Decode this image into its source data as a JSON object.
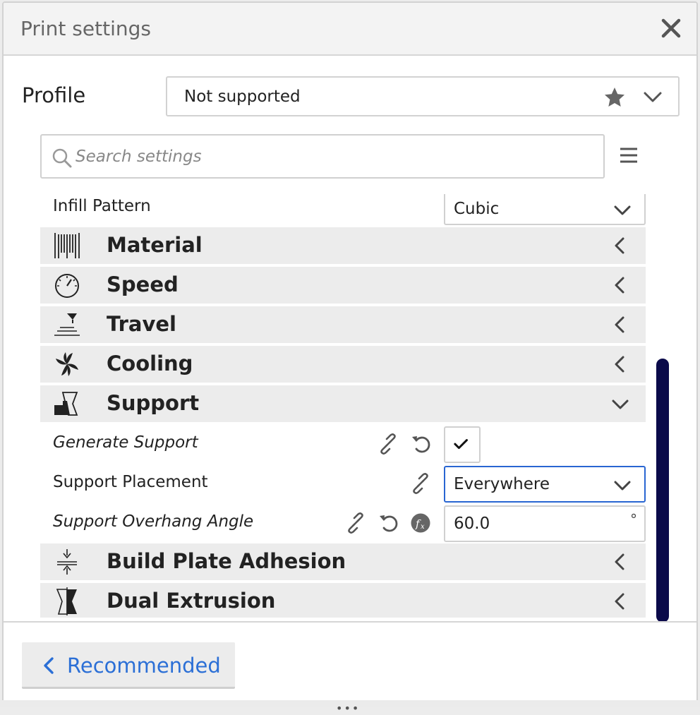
{
  "window": {
    "title": "Print settings"
  },
  "profile": {
    "label": "Profile",
    "value": "Not supported"
  },
  "search": {
    "placeholder": "Search settings"
  },
  "settings": {
    "infill_pattern": {
      "label": "Infill Pattern",
      "value": "Cubic"
    },
    "categories": [
      {
        "name": "Material",
        "icon": "material-icon",
        "expanded": false
      },
      {
        "name": "Speed",
        "icon": "speed-gauge-icon",
        "expanded": false
      },
      {
        "name": "Travel",
        "icon": "travel-icon",
        "expanded": false
      },
      {
        "name": "Cooling",
        "icon": "fan-icon",
        "expanded": false
      },
      {
        "name": "Support",
        "icon": "support-icon",
        "expanded": true
      },
      {
        "name": "Build Plate Adhesion",
        "icon": "adhesion-icon",
        "expanded": false
      },
      {
        "name": "Dual Extrusion",
        "icon": "dual-extrusion-icon",
        "expanded": false
      }
    ],
    "support": {
      "generate_support": {
        "label": "Generate Support",
        "checked": true
      },
      "support_placement": {
        "label": "Support Placement",
        "value": "Everywhere"
      },
      "overhang_angle": {
        "label": "Support Overhang Angle",
        "value": "60.0",
        "unit": "°"
      }
    }
  },
  "footer": {
    "recommended_label": "Recommended",
    "grip": "•••"
  },
  "colors": {
    "accent": "#2b6fd6",
    "scrollbar": "#0b0a4a",
    "category_bg": "#ececec"
  }
}
